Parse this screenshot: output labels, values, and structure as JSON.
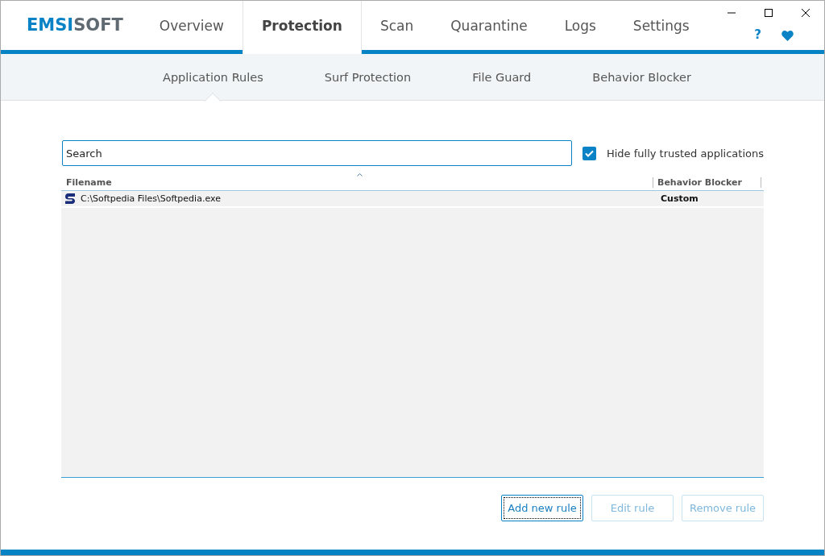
{
  "logo": {
    "accent": "EMSI",
    "rest": "SOFT"
  },
  "tabs": [
    {
      "label": "Overview",
      "selected": false
    },
    {
      "label": "Protection",
      "selected": true
    },
    {
      "label": "Scan",
      "selected": false
    },
    {
      "label": "Quarantine",
      "selected": false
    },
    {
      "label": "Logs",
      "selected": false
    },
    {
      "label": "Settings",
      "selected": false
    }
  ],
  "help": "?",
  "subtabs": [
    {
      "label": "Application Rules",
      "selected": true
    },
    {
      "label": "Surf Protection",
      "selected": false
    },
    {
      "label": "File Guard",
      "selected": false
    },
    {
      "label": "Behavior Blocker",
      "selected": false
    }
  ],
  "search": {
    "placeholder": "Search"
  },
  "hide_trusted": {
    "label": "Hide fully trusted applications",
    "checked": true
  },
  "table": {
    "columns": [
      "Filename",
      "Behavior Blocker"
    ],
    "rows": [
      {
        "cells": [
          "C:\\Softpedia Files\\Softpedia.exe",
          "Custom"
        ]
      }
    ]
  },
  "buttons": [
    {
      "label": "Add new rule",
      "disabled": false
    },
    {
      "label": "Edit rule",
      "disabled": true
    },
    {
      "label": "Remove rule",
      "disabled": true
    }
  ]
}
